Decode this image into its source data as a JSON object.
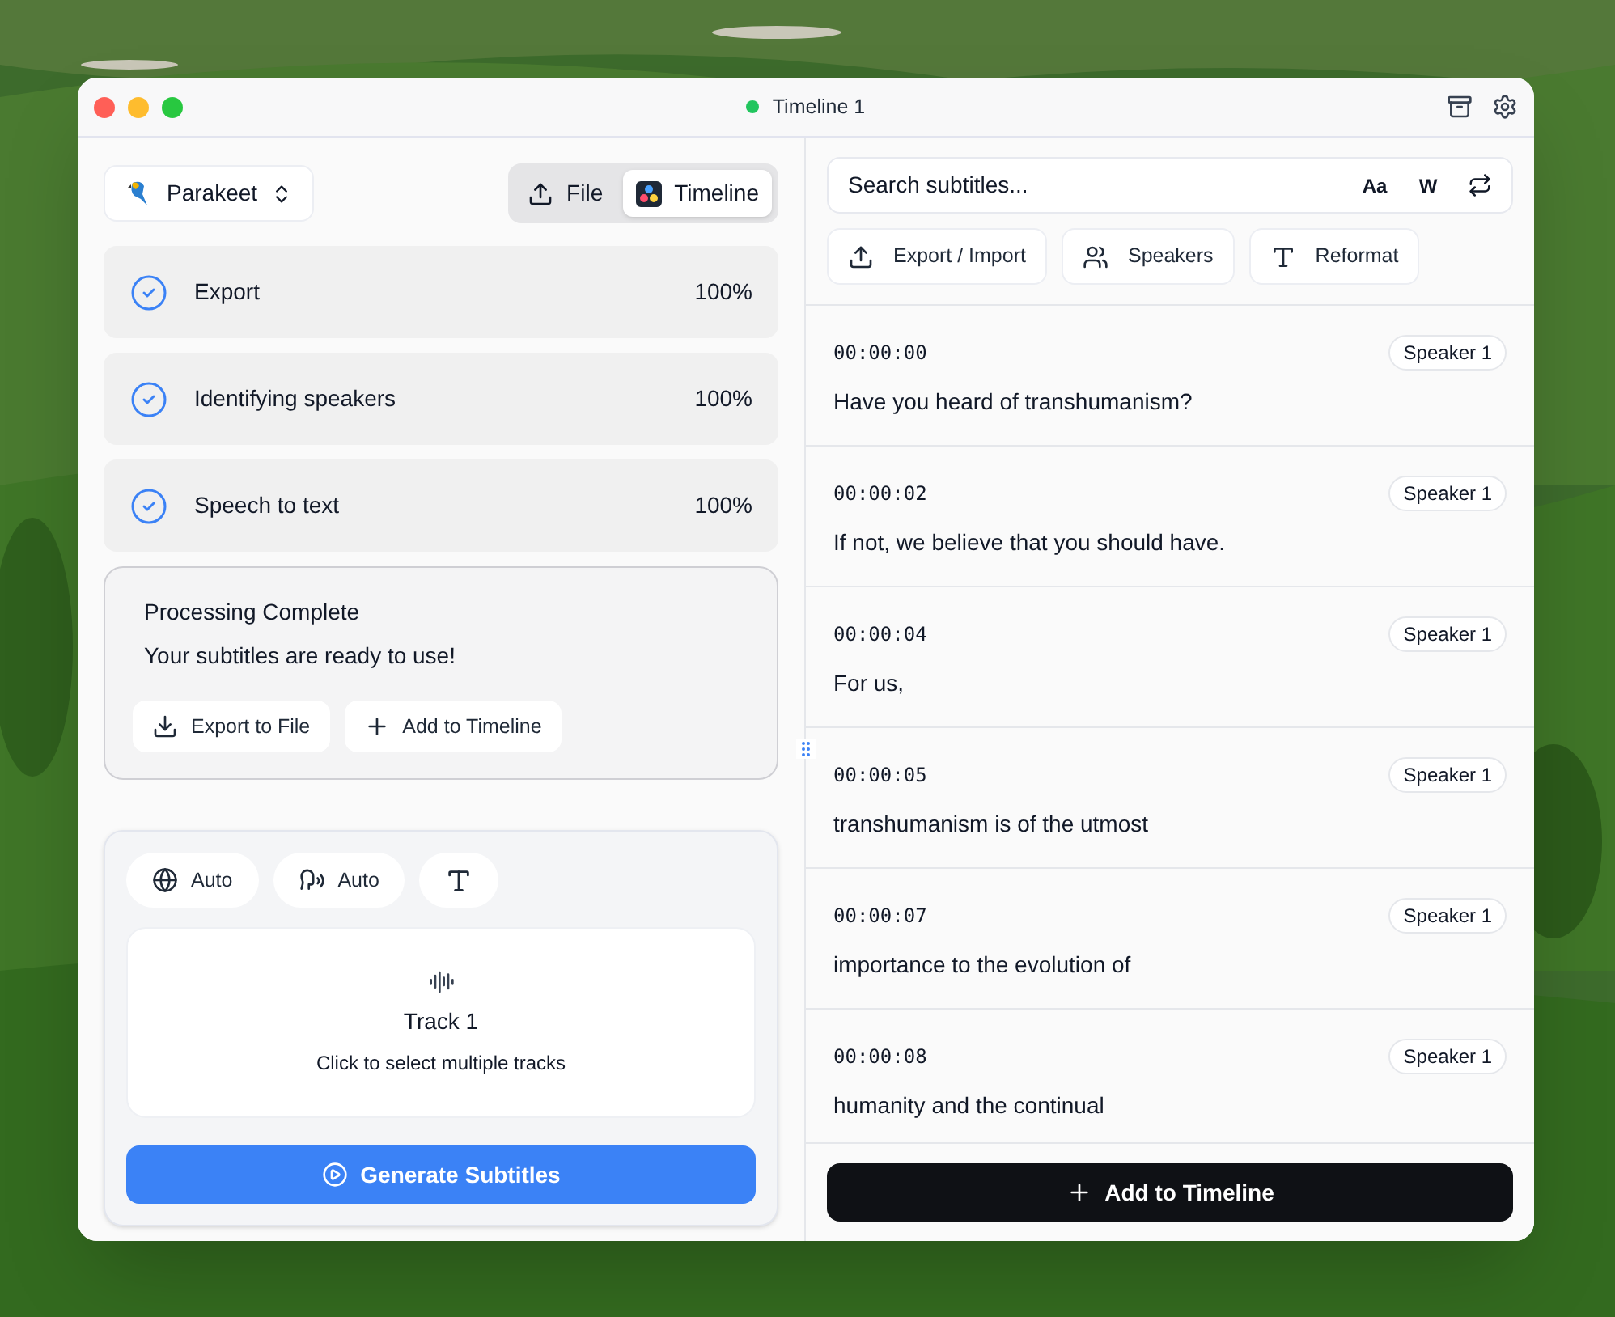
{
  "window": {
    "title": "Timeline 1"
  },
  "model_selector": {
    "label": "Parakeet"
  },
  "source_tabs": [
    {
      "label": "File",
      "kind": "upload",
      "selected": false
    },
    {
      "label": "Timeline",
      "kind": "resolve",
      "selected": true
    }
  ],
  "steps": [
    {
      "label": "Export",
      "percent": "100%",
      "done": true
    },
    {
      "label": "Identifying speakers",
      "percent": "100%",
      "done": true
    },
    {
      "label": "Speech to text",
      "percent": "100%",
      "done": true
    }
  ],
  "completion": {
    "title": "Processing Complete",
    "message": "Your subtitles are ready to use!",
    "buttons": [
      {
        "label": "Export to File",
        "kind": "download"
      },
      {
        "label": "Add to Timeline",
        "kind": "add"
      }
    ]
  },
  "options": [
    {
      "kind": "language",
      "label": "Auto"
    },
    {
      "kind": "speaker",
      "label": "Auto"
    },
    {
      "kind": "format"
    }
  ],
  "track": {
    "title": "Track 1",
    "hint": "Click to select multiple tracks"
  },
  "generate_button": {
    "label": "Generate Subtitles"
  },
  "search": {
    "placeholder": "Search subtitles...",
    "toggles": [
      "Aa",
      "W"
    ]
  },
  "toolbar": [
    {
      "label": "Export / Import",
      "kind": "upload"
    },
    {
      "label": "Speakers",
      "kind": "users"
    },
    {
      "label": "Reformat",
      "kind": "type"
    }
  ],
  "subtitles": [
    {
      "time": "00:00:00",
      "speaker": "Speaker 1",
      "text": "Have you heard of transhumanism?"
    },
    {
      "time": "00:00:02",
      "speaker": "Speaker 1",
      "text": "If not, we believe that you should have."
    },
    {
      "time": "00:00:04",
      "speaker": "Speaker 1",
      "text": "For us,"
    },
    {
      "time": "00:00:05",
      "speaker": "Speaker 1",
      "text": "transhumanism is of the utmost"
    },
    {
      "time": "00:00:07",
      "speaker": "Speaker 1",
      "text": "importance to the evolution of"
    },
    {
      "time": "00:00:08",
      "speaker": "Speaker 1",
      "text": "humanity and the continual"
    }
  ],
  "add_button": {
    "label": "Add to Timeline"
  }
}
